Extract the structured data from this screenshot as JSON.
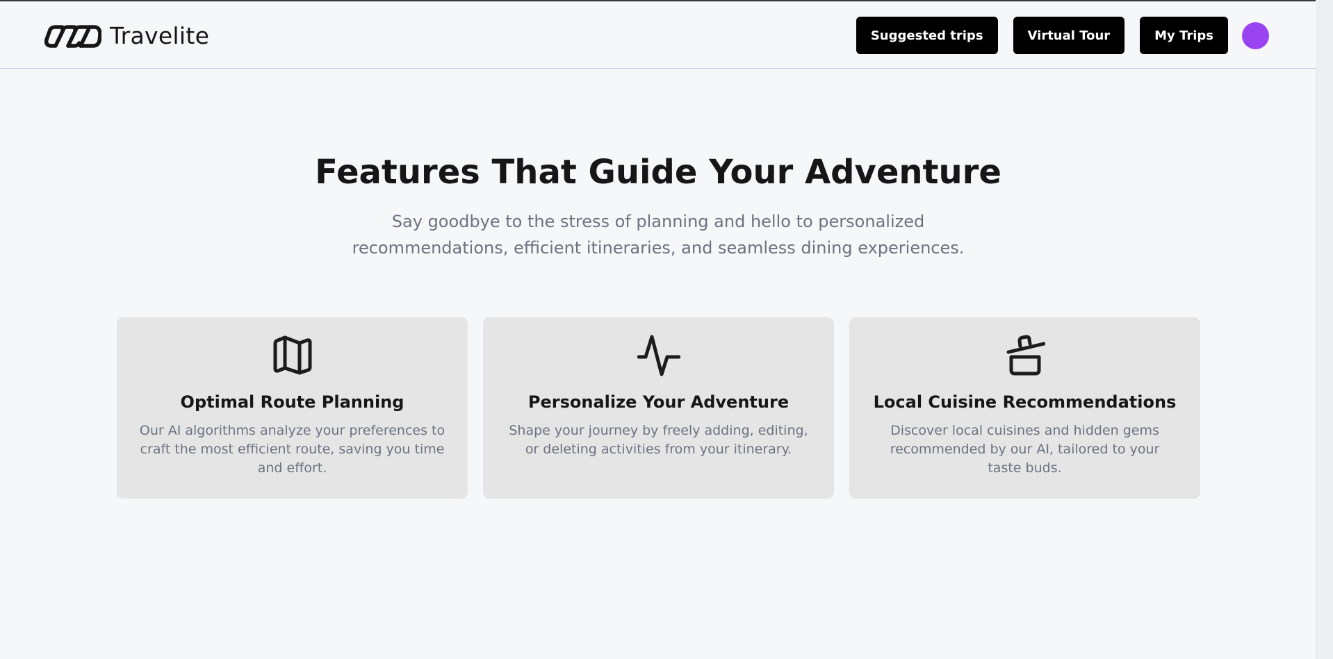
{
  "brand": {
    "name": "Travelite",
    "logo_icon": "infinity-chain-logo-icon"
  },
  "nav": {
    "buttons": [
      {
        "label": "Suggested trips"
      },
      {
        "label": "Virtual Tour"
      },
      {
        "label": "My Trips"
      }
    ],
    "avatar_color": "#9a43f0"
  },
  "hero": {
    "title": "Features That Guide Your Adventure",
    "subtitle": "Say goodbye to the stress of planning and hello to personalized recommendations, efficient itineraries, and seamless dining experiences."
  },
  "features": [
    {
      "icon": "map-icon",
      "title": "Optimal Route Planning",
      "description": "Our AI algorithms analyze your preferences to craft the most efficient route, saving you time and effort."
    },
    {
      "icon": "activity-pulse-icon",
      "title": "Personalize Your Adventure",
      "description": "Shape your journey by freely adding, editing, or deleting activities from your itinerary."
    },
    {
      "icon": "cooking-pot-icon",
      "title": "Local Cuisine Recommendations",
      "description": "Discover local cuisines and hidden gems recommended by our AI, tailored to your taste buds."
    }
  ],
  "colors": {
    "background": "#f6f7f9",
    "button_bg": "#000000",
    "button_text": "#ffffff",
    "card_bg": "#e5e5e5",
    "muted_text": "#6b7280",
    "accent": "#9a43f0"
  }
}
